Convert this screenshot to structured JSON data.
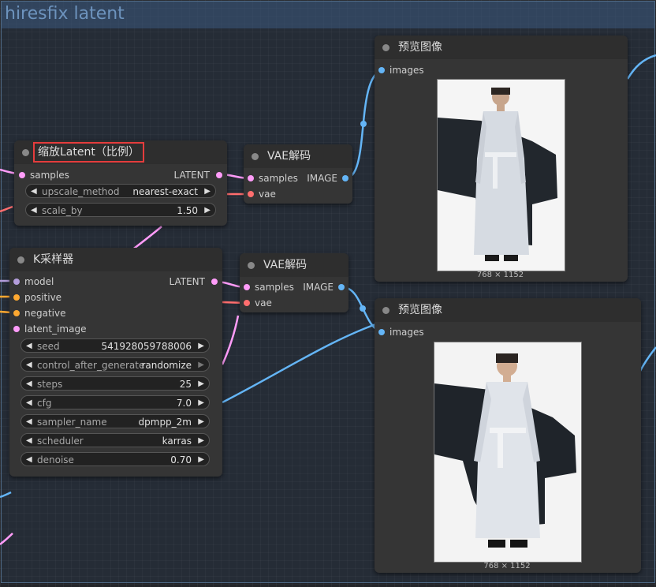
{
  "group": {
    "title": "hiresfix latent"
  },
  "colors": {
    "latent": "#ff9cf9",
    "image": "#64b5f6",
    "vae": "#ff6e6e",
    "conditioning": "#ffa931",
    "model": "#b39ddb",
    "highlight": "#e53c3c"
  },
  "nodes": {
    "upscale": {
      "title": "缩放Latent（比例）",
      "input_samples": "samples",
      "output_latent": "LATENT",
      "widgets": [
        {
          "label": "upscale_method",
          "value": "nearest-exact"
        },
        {
          "label": "scale_by",
          "value": "1.50"
        }
      ]
    },
    "vae_decode_1": {
      "title": "VAE解码",
      "input_samples": "samples",
      "input_vae": "vae",
      "output_image": "IMAGE"
    },
    "vae_decode_2": {
      "title": "VAE解码",
      "input_samples": "samples",
      "input_vae": "vae",
      "output_image": "IMAGE"
    },
    "ksampler": {
      "title": "K采样器",
      "inputs": [
        "model",
        "positive",
        "negative",
        "latent_image"
      ],
      "output_latent": "LATENT",
      "widgets": [
        {
          "label": "seed",
          "value": "541928059788006"
        },
        {
          "label": "control_after_generate",
          "value": "randomize"
        },
        {
          "label": "steps",
          "value": "25"
        },
        {
          "label": "cfg",
          "value": "7.0"
        },
        {
          "label": "sampler_name",
          "value": "dpmpp_2m"
        },
        {
          "label": "scheduler",
          "value": "karras"
        },
        {
          "label": "denoise",
          "value": "0.70"
        }
      ]
    },
    "preview_1": {
      "title": "预览图像",
      "input_images": "images",
      "caption": "768 × 1152",
      "image_icon": "person-in-robe-image"
    },
    "preview_2": {
      "title": "预览图像",
      "input_images": "images",
      "caption": "768 × 1152",
      "image_icon": "person-in-robe-image"
    }
  }
}
